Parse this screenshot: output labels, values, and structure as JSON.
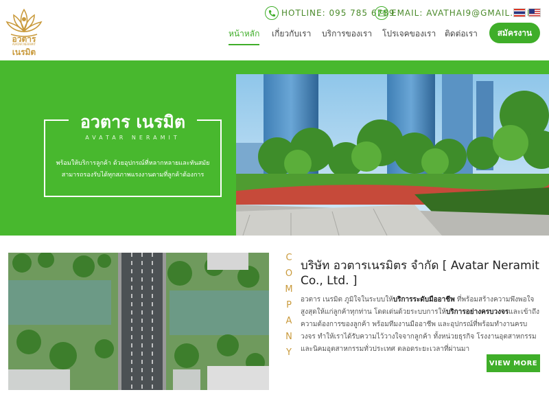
{
  "logo": {
    "name": "อวตาร เนรมิต",
    "tagline": "AVATAR NERAMIT"
  },
  "contact": {
    "hotline": "HOTLINE: 095 785 6789",
    "email": "EMAIL: AVATHAI9@GMAIL.COM"
  },
  "nav": {
    "items": [
      "หน้าหลัก",
      "เกี่ยวกับเรา",
      "บริการของเรา",
      "โปรเจคของเรา",
      "ติดต่อเรา"
    ],
    "active": "หน้าหลัก",
    "apply_label": "สมัครงาน"
  },
  "hero": {
    "title": "อวตาร เนรมิต",
    "subtitle": "AVATAR NERAMIT",
    "description_line1": "พร้อมให้บริการลูกค้า ด้วยอุปกรณ์ที่หลากหลายและทันสมัย",
    "description_line2": "สามารถรองรับได้ทุกสภาพแรงงานตามที่ลูกค้าต้องการ"
  },
  "company": {
    "vertical_word": [
      "C",
      "O",
      "M",
      "P",
      "A",
      "N",
      "Y"
    ],
    "title": "บริษัท อวตารเนรมิตร จำกัด [ Avatar Neramit Co., Ltd. ]",
    "desc_part1": "อวตาร เนรมิต ภูมิใจในระบบให้",
    "desc_bold1": "บริการระดับมืออาชีพ",
    "desc_part2": " ที่พร้อมสร้างความพึงพอใจสูงสุดให้แก่ลูกค้าทุกท่าน โดดเด่นด้วยระบบการให้",
    "desc_bold2": "บริการอย่างครบวงจร",
    "desc_part3": "และเข้าถึงความต้องการของลูกค้า พร้อมทีมงานมืออาชีพ และอุปกรณ์ที่พร้อมทำงานครบวงจร ทำให้เราได้รับความไว้วางใจจากลูกค้า ทั้งหน่วยธุรกิจ โรงงานอุตสาหกรรม และนิคมอุตสาหกรรมทั่วประเทศ ตลอดระยะเวลาที่ผ่านมา",
    "view_more": "VIEW MORE"
  },
  "colors": {
    "brand_green": "#3fae29",
    "hero_green": "#48b82e",
    "gold": "#c99a3c"
  }
}
